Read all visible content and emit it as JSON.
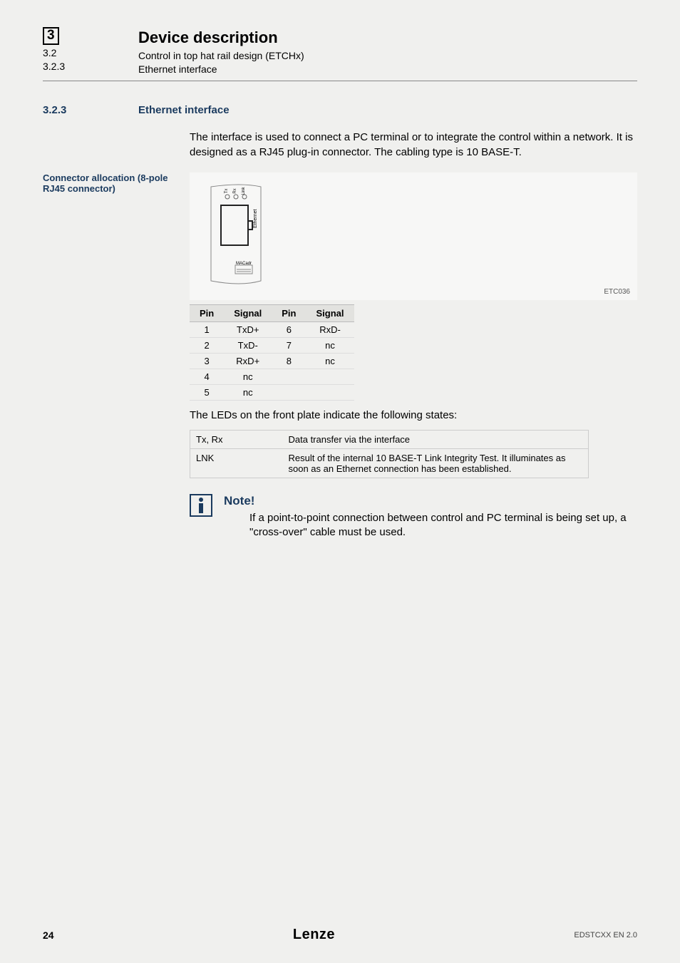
{
  "header": {
    "chapter_num": "3",
    "sub_num": "3.2",
    "subsub_num": "3.2.3",
    "title": "Device description",
    "subtitle": "Control in top hat rail design (ETCHx)",
    "subsubtitle": "Ethernet interface"
  },
  "section": {
    "num": "3.2.3",
    "title": "Ethernet interface",
    "intro": "The interface is used to connect a PC terminal or to integrate the control within a network. It is designed as a RJ45 plug-in connector. The cabling type is 10 BASE-T."
  },
  "figure": {
    "side_label": "Connector allocation (8-pole RJ45 connector)",
    "caption": "ETC036",
    "port_text": "Ethernet",
    "mac_text": "MACadr",
    "led_tx": "Tx",
    "led_rx": "Rx",
    "led_link": "Link"
  },
  "pin_table": {
    "headers": {
      "pin": "Pin",
      "signal": "Signal"
    },
    "rows": [
      {
        "pin1": "1",
        "sig1": "TxD+",
        "pin2": "6",
        "sig2": "RxD-"
      },
      {
        "pin1": "2",
        "sig1": "TxD-",
        "pin2": "7",
        "sig2": "nc"
      },
      {
        "pin1": "3",
        "sig1": "RxD+",
        "pin2": "8",
        "sig2": "nc"
      },
      {
        "pin1": "4",
        "sig1": "nc",
        "pin2": "",
        "sig2": ""
      },
      {
        "pin1": "5",
        "sig1": "nc",
        "pin2": "",
        "sig2": ""
      }
    ]
  },
  "led_intro": "The LEDs on the front plate indicate the following states:",
  "led_table": {
    "rows": [
      {
        "name": "Tx, Rx",
        "desc": "Data transfer via the interface"
      },
      {
        "name": "LNK",
        "desc": "Result of the internal 10 BASE-T Link Integrity Test. It illuminates as soon as an Ethernet connection has been established."
      }
    ]
  },
  "note": {
    "title": "Note!",
    "body": "If a point-to-point connection between control and PC terminal is being set up, a \"cross-over\" cable must be used."
  },
  "footer": {
    "page": "24",
    "brand": "Lenze",
    "doc_id": "EDSTCXX EN 2.0"
  }
}
